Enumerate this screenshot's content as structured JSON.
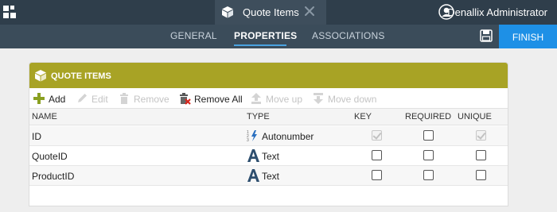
{
  "topbar": {
    "document_tab_title": "Quote Items",
    "user_name": "Denallix Administrator"
  },
  "subnav": {
    "tabs": [
      {
        "label": "GENERAL",
        "active": false
      },
      {
        "label": "PROPERTIES",
        "active": true
      },
      {
        "label": "ASSOCIATIONS",
        "active": false
      }
    ],
    "finish_label": "FINISH"
  },
  "panel": {
    "title": "QUOTE ITEMS",
    "header_color": "#a8a325",
    "toolbar": {
      "add": "Add",
      "edit": "Edit",
      "remove": "Remove",
      "remove_all": "Remove All",
      "move_up": "Move up",
      "move_down": "Move down"
    },
    "columns": {
      "name": "NAME",
      "type": "TYPE",
      "key": "KEY",
      "required": "REQUIRED",
      "unique": "UNIQUE"
    },
    "rows": [
      {
        "name": "ID",
        "type": "Autonumber",
        "type_icon": "autonumber-icon",
        "key": true,
        "key_locked": true,
        "required": false,
        "unique": true,
        "unique_locked": true
      },
      {
        "name": "QuoteID",
        "type": "Text",
        "type_icon": "text-type-icon",
        "key": false,
        "required": false,
        "unique": false
      },
      {
        "name": "ProductID",
        "type": "Text",
        "type_icon": "text-type-icon",
        "key": false,
        "required": false,
        "unique": false
      }
    ]
  },
  "colors": {
    "topbar": "#2f3e4b",
    "subnav": "#3b4c5a",
    "accent_blue": "#1e90e6",
    "panel_header": "#a8a325"
  }
}
